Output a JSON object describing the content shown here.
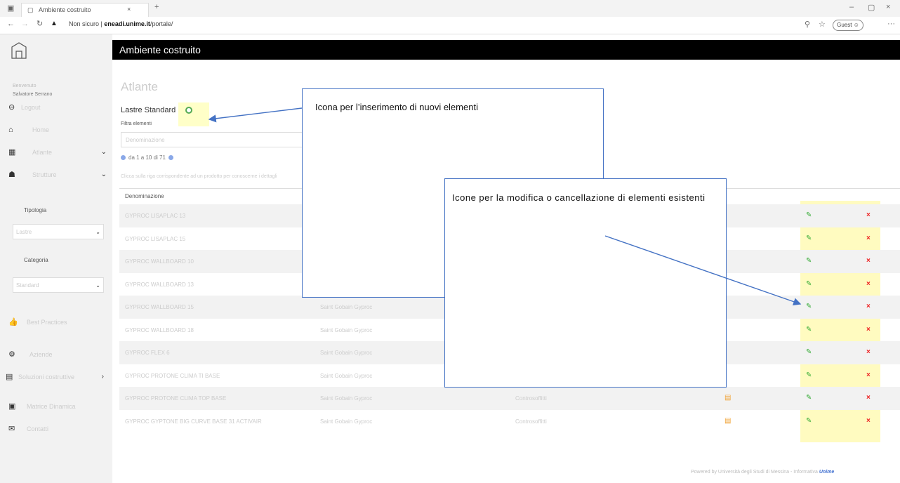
{
  "browser": {
    "tab_title": "Ambiente costruito",
    "url_warning": "Non sicuro",
    "url_host": "eneadi.unime.it",
    "url_path": "/portale/",
    "guest_label": "Guest"
  },
  "header": {
    "title": "Ambiente costruito"
  },
  "sidebar": {
    "welcome": "Benvenuto",
    "user": "Salvatore Serrano",
    "logout": "Logout",
    "items": [
      {
        "label": "Home"
      },
      {
        "label": "Atlante"
      },
      {
        "label": "Strutture"
      }
    ],
    "tipologia_label": "Tipologia",
    "tipologia_value": "Lastre",
    "categoria_label": "Categoria",
    "categoria_value": "Standard",
    "best_practices": "Best Practices",
    "aziende": "Aziende",
    "soluzioni": "Soluzioni costruttive",
    "matrice": "Matrice Dinamica",
    "contatti": "Contatti"
  },
  "main": {
    "title": "Atlante",
    "section": "Lastre Standard",
    "filter_label": "Filtra elementi",
    "filter_placeholder": "Denominazione",
    "pager": "da 1 a 10 di 71",
    "hint": "Clicca sulla riga corrispondente ad un prodotto per conoscerne i dettagli",
    "table": {
      "header": "Denominazione",
      "rows": [
        {
          "name": "GYPROC LISAPLAC 13",
          "maker": "",
          "type": "",
          "doc": false
        },
        {
          "name": "GYPROC LISAPLAC 15",
          "maker": "",
          "type": "",
          "doc": false
        },
        {
          "name": "GYPROC WALLBOARD 10",
          "maker": "",
          "type": "",
          "doc": false
        },
        {
          "name": "GYPROC WALLBOARD 13",
          "maker": "",
          "type": "",
          "doc": false
        },
        {
          "name": "GYPROC WALLBOARD 15",
          "maker": "Saint Gobain Gyproc",
          "type": "",
          "doc": false
        },
        {
          "name": "GYPROC WALLBOARD 18",
          "maker": "Saint Gobain Gyproc",
          "type": "",
          "doc": false
        },
        {
          "name": "GYPROC FLEX 6",
          "maker": "Saint Gobain Gyproc",
          "type": "",
          "doc": false
        },
        {
          "name": "GYPROC PROTONE CLIMA TI BASE",
          "maker": "Saint Gobain Gyproc",
          "type": "",
          "doc": false
        },
        {
          "name": "GYPROC PROTONE CLIMA TOP BASE",
          "maker": "Saint Gobain Gyproc",
          "type": "Controsoffitti",
          "doc": true
        },
        {
          "name": "GYPROC GYPTONE BIG CURVE BASE 31 ACTIVAIR",
          "maker": "Saint Gobain Gyproc",
          "type": "Controsoffitti",
          "doc": true
        }
      ]
    }
  },
  "callouts": {
    "add": "Icona per l’inserimento di nuovi elementi",
    "edit": "Icone per la modifica o cancellazione di elementi esistenti"
  },
  "footer": "Powered by Università degli Studi di Messina - Informativa",
  "footer_brand": "Unime",
  "colors": {
    "arrow": "#4472c4",
    "highlight": "#ffffc8",
    "edit": "#33aa33",
    "delete": "#ee2222"
  }
}
